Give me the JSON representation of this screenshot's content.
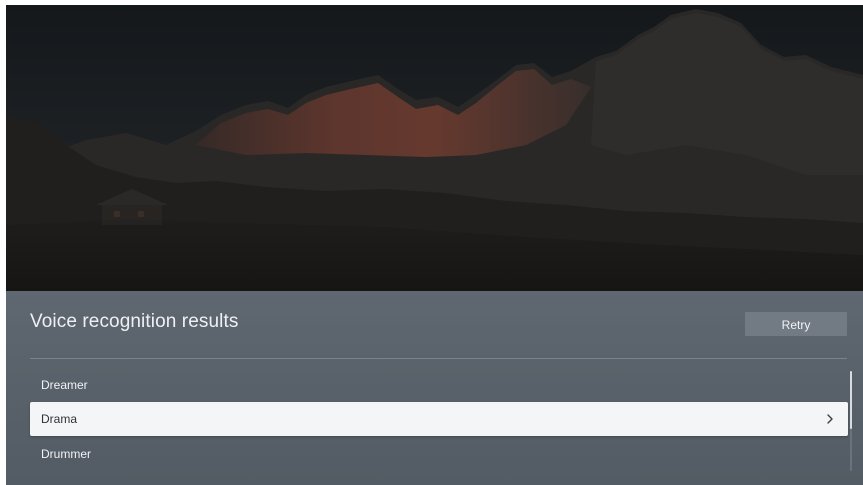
{
  "panel": {
    "title": "Voice recognition results",
    "retry_label": "Retry",
    "results": [
      {
        "label": "Dreamer",
        "selected": false
      },
      {
        "label": "Drama",
        "selected": true
      },
      {
        "label": "Drummer",
        "selected": false
      }
    ],
    "selected_icon": "chevron-right-icon"
  },
  "backdrop": {
    "scene": "dim mountain landscape at dusk",
    "sky_color": "#16191c",
    "peak_glow_color": "#7a3a2e"
  },
  "colors": {
    "panel_background": "#5b636c",
    "selected_row_background": "#f4f5f6",
    "retry_button_background": "#727a83"
  },
  "scroll": {
    "position": 0,
    "visible_fraction": 0.58
  }
}
